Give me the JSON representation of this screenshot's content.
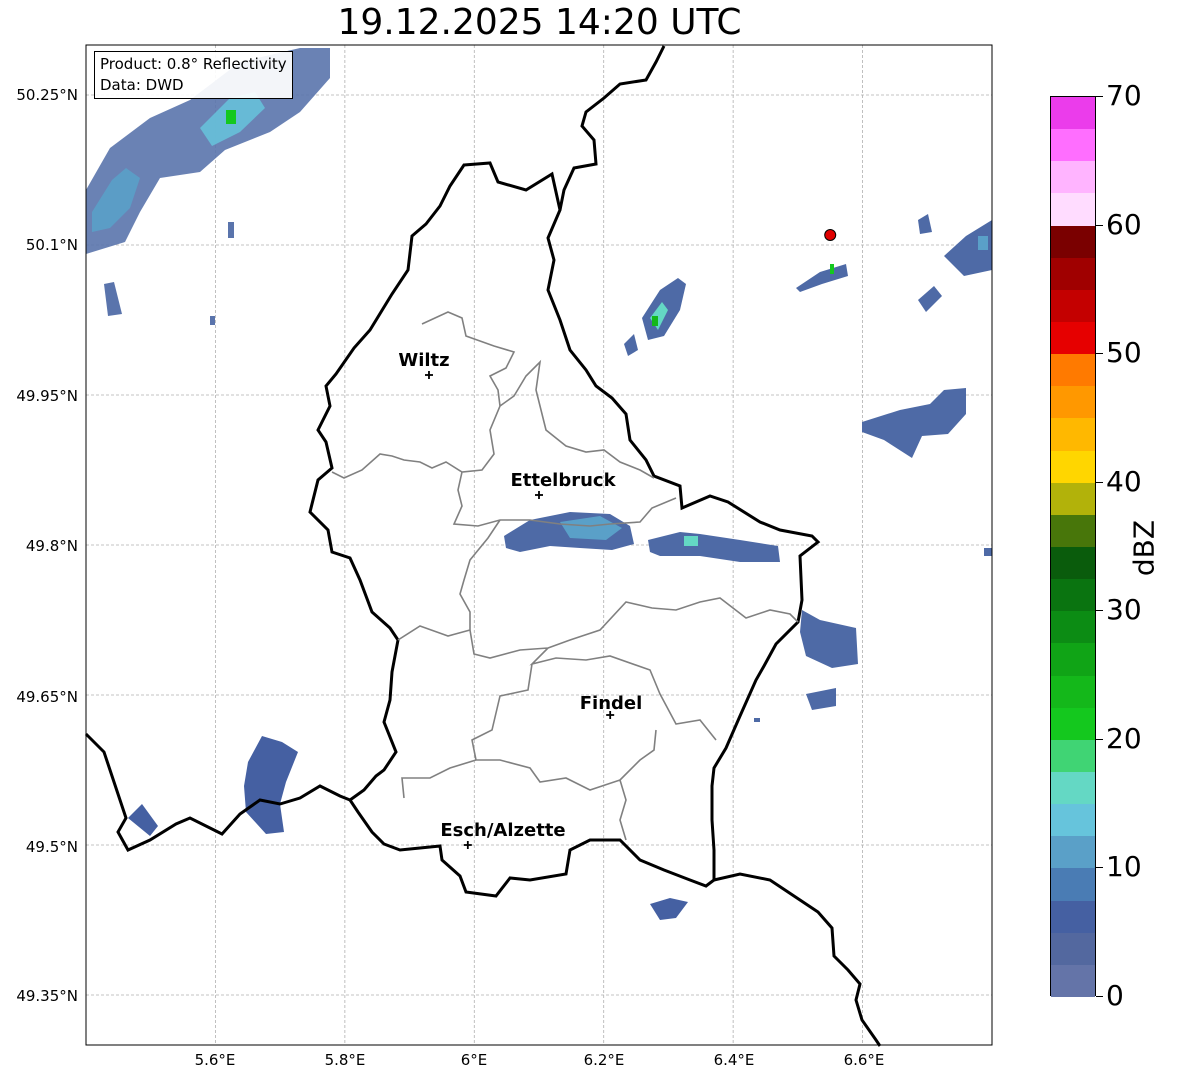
{
  "title": "19.12.2025 14:20 UTC",
  "info": {
    "product": "Product: 0.8° Reflectivity",
    "data": "Data: DWD"
  },
  "axes": {
    "lat_labels": [
      "50.25°N",
      "50.1°N",
      "49.95°N",
      "49.8°N",
      "49.65°N",
      "49.5°N",
      "49.35°N"
    ],
    "lon_labels": [
      "5.6°E",
      "5.8°E",
      "6°E",
      "6.2°E",
      "6.4°E",
      "6.6°E"
    ],
    "lat_range": [
      49.3,
      50.3
    ],
    "lon_range": [
      5.4,
      6.8
    ],
    "gridlines": true
  },
  "cities": [
    {
      "name": "Wiltz",
      "lon": 5.93,
      "lat": 49.97
    },
    {
      "name": "Ettelbruck",
      "lon": 6.1,
      "lat": 49.85
    },
    {
      "name": "Findel",
      "lon": 6.21,
      "lat": 49.63
    },
    {
      "name": "Esch/Alzette",
      "lon": 5.99,
      "lat": 49.5
    }
  ],
  "radar_site": {
    "lon": 6.55,
    "lat": 50.11,
    "color": "#e00000"
  },
  "colorbar": {
    "label": "dBZ",
    "min": 0,
    "max": 70,
    "tick_labels": [
      "0",
      "10",
      "20",
      "30",
      "40",
      "50",
      "60",
      "70"
    ],
    "colors": [
      "#6474a8",
      "#53689f",
      "#4560a2",
      "#4a7cb4",
      "#5aa0c8",
      "#66c4dc",
      "#64d8c4",
      "#40d474",
      "#14c81e",
      "#14b81a",
      "#10a416",
      "#0c8c14",
      "#0a7410",
      "#0a5c0c",
      "#48760a",
      "#b2b20a",
      "#ffd600",
      "#ffb800",
      "#ff9800",
      "#ff7a00",
      "#e60000",
      "#c40000",
      "#a00000",
      "#7a0000",
      "#ffdcff",
      "#ffb4ff",
      "#ff6eff",
      "#eb3ceb"
    ]
  }
}
